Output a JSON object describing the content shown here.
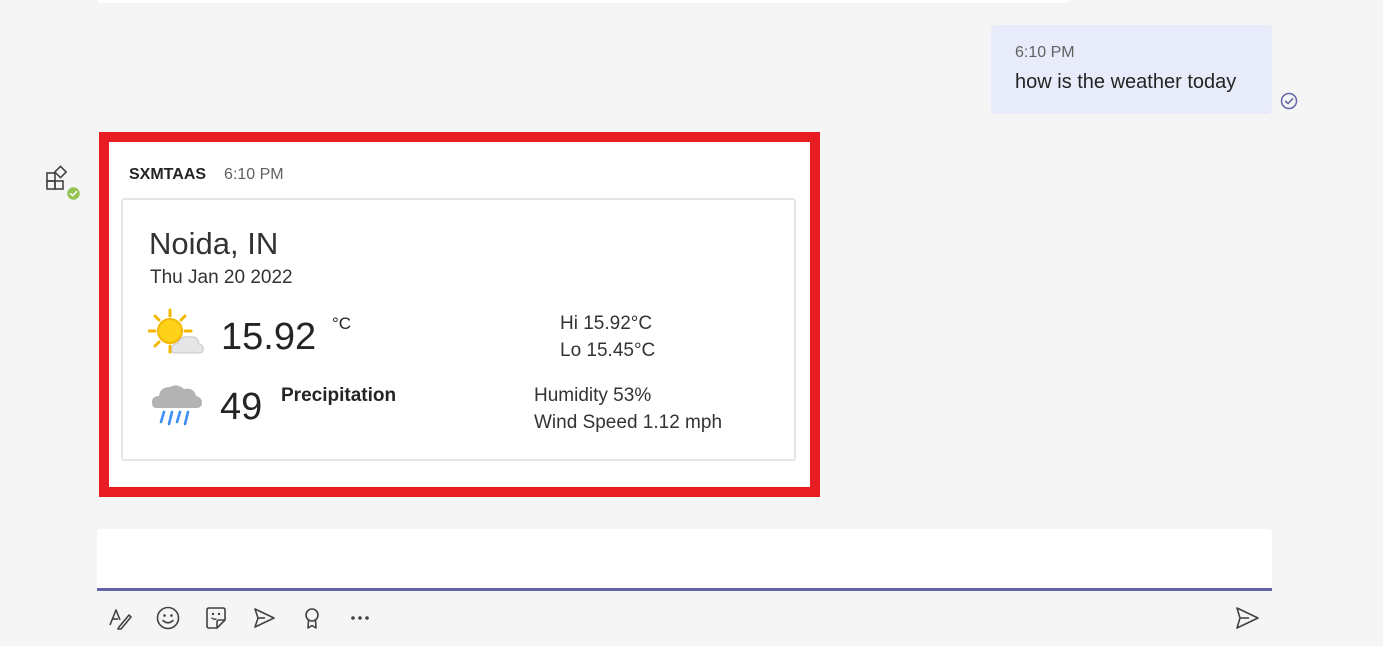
{
  "user_message": {
    "time": "6:10 PM",
    "text": "how is the weather today"
  },
  "bot_message": {
    "sender": "SXMTAAS",
    "time": "6:10 PM"
  },
  "weather_card": {
    "city": "Noida, IN",
    "date": "Thu Jan 20 2022",
    "temperature": "15.92",
    "unit": "°C",
    "hi": "Hi 15.92°C",
    "lo": "Lo 15.45°C",
    "precipitation_value": "49",
    "precipitation_label": "Precipitation",
    "humidity": "Humidity 53%",
    "wind": "Wind Speed 1.12 mph",
    "icons": [
      "partly-sunny-icon",
      "rain-cloud-icon"
    ]
  },
  "toolbar": {
    "icons": [
      "format-icon",
      "emoji-icon",
      "sticker-icon",
      "schedule-send-icon",
      "praise-icon",
      "more-options-icon",
      "send-icon"
    ]
  },
  "colors": {
    "highlight": "#e81c23",
    "accent": "#6264a7",
    "user_bubble": "#e8ebfa",
    "presence": "#92c353"
  }
}
